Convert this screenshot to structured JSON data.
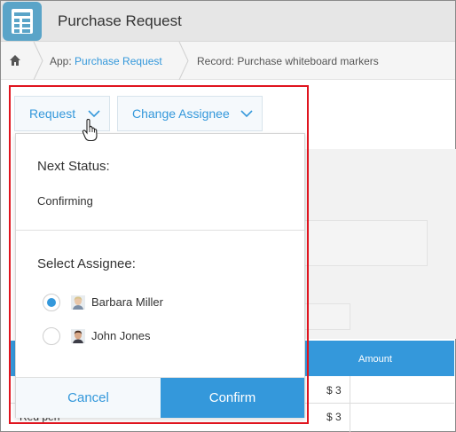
{
  "header": {
    "title": "Purchase Request"
  },
  "breadcrumb": {
    "app_prefix": "App: ",
    "app_name": "Purchase Request",
    "record": "Record: Purchase whiteboard markers"
  },
  "actions": {
    "request_label": "Request",
    "change_assignee_label": "Change Assignee"
  },
  "panel": {
    "next_status_heading": "Next Status:",
    "next_status_value": "Confirming",
    "select_assignee_heading": "Select Assignee:",
    "assignees": [
      {
        "name": "Barbara Miller",
        "selected": true
      },
      {
        "name": "John Jones",
        "selected": false
      }
    ],
    "cancel_label": "Cancel",
    "confirm_label": "Confirm"
  },
  "table": {
    "amount_header": "Amount",
    "rows": [
      {
        "item": "",
        "amount": "$ 3"
      },
      {
        "item": "Red pen",
        "amount": "$ 3"
      }
    ]
  },
  "colors": {
    "accent": "#3498db",
    "highlight": "#e0141e",
    "header_bg": "#e6e6e6"
  },
  "icons": {
    "app": "spreadsheet-icon",
    "home": "home-icon",
    "chevron": "chevron-down-icon",
    "cursor": "hand-pointer-icon"
  }
}
